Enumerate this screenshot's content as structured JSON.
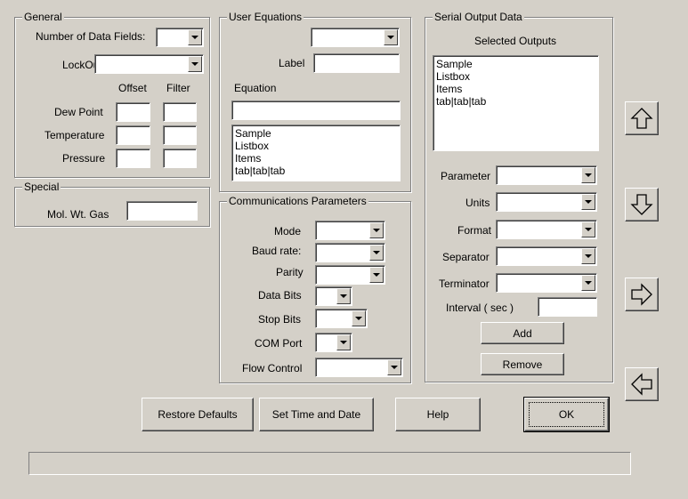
{
  "general": {
    "title": "General",
    "num_fields_label": "Number of Data Fields:",
    "num_fields_value": "",
    "lockout_label": "LockOut",
    "lockout_value": "",
    "offset_header": "Offset",
    "filter_header": "Filter",
    "dew_point_label": "Dew Point",
    "temperature_label": "Temperature",
    "pressure_label": "Pressure"
  },
  "special": {
    "title": "Special",
    "mol_wt_label": "Mol. Wt. Gas",
    "mol_wt_value": ""
  },
  "user_equations": {
    "title": "User Equations",
    "select_value": "",
    "label_label": "Label",
    "label_value": "",
    "equation_label": "Equation",
    "equation_value": "",
    "list_items": [
      "Sample",
      "Listbox",
      "Items",
      "tab|tab|tab"
    ]
  },
  "comms": {
    "title": "Communications Parameters",
    "mode_label": "Mode",
    "baud_label": "Baud rate:",
    "parity_label": "Parity",
    "data_bits_label": "Data Bits",
    "stop_bits_label": "Stop Bits",
    "com_port_label": "COM Port",
    "flow_control_label": "Flow Control"
  },
  "serial_output": {
    "title": "Serial Output Data",
    "selected_outputs_label": "Selected Outputs",
    "list_items": [
      "Sample",
      "Listbox",
      "Items",
      "tab|tab|tab"
    ],
    "parameter_label": "Parameter",
    "units_label": "Units",
    "format_label": "Format",
    "separator_label": "Separator",
    "terminator_label": "Terminator",
    "interval_label": "Interval ( sec )",
    "interval_value": "",
    "add_label": "Add",
    "remove_label": "Remove"
  },
  "arrows": {
    "up_icon": "arrow-up-icon",
    "down_icon": "arrow-down-icon",
    "right_icon": "arrow-right-icon",
    "left_icon": "arrow-left-icon"
  },
  "footer": {
    "restore_defaults_label": "Restore Defaults",
    "set_time_label": "Set Time and Date",
    "help_label": "Help",
    "ok_label": "OK"
  },
  "status_text": ""
}
